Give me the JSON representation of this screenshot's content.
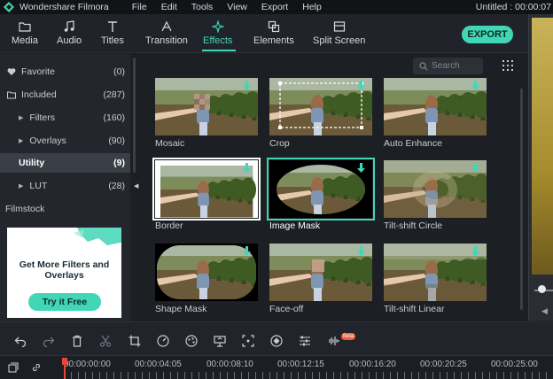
{
  "window": {
    "app_name": "Wondershare Filmora",
    "doc_title": "Untitled : 00:00:07",
    "menu": [
      "File",
      "Edit",
      "Tools",
      "View",
      "Export",
      "Help"
    ]
  },
  "toolbar": {
    "tabs": [
      {
        "label": "Media",
        "icon": "folder-icon"
      },
      {
        "label": "Audio",
        "icon": "music-note-icon"
      },
      {
        "label": "Titles",
        "icon": "text-icon"
      },
      {
        "label": "Transition",
        "icon": "transition-icon"
      },
      {
        "label": "Effects",
        "icon": "sparkle-icon",
        "active": true
      },
      {
        "label": "Elements",
        "icon": "elements-icon"
      },
      {
        "label": "Split Screen",
        "icon": "split-screen-icon"
      }
    ],
    "export_label": "EXPORT",
    "accent": "#41d6b6"
  },
  "sidebar": {
    "items": [
      {
        "label": "Favorite",
        "count": "(0)",
        "icon": "heart-icon"
      },
      {
        "label": "Included",
        "count": "(287)",
        "icon": "folder-icon"
      },
      {
        "label": "Filters",
        "count": "(160)"
      },
      {
        "label": "Overlays",
        "count": "(90)"
      },
      {
        "label": "Utility",
        "count": "(9)",
        "active": true
      },
      {
        "label": "LUT",
        "count": "(28)"
      }
    ],
    "filmstock_label": "Filmstock",
    "ad": {
      "title": "Get More Filters and Overlays",
      "button": "Try it Free"
    }
  },
  "search": {
    "placeholder": "Search"
  },
  "effects": [
    {
      "label": "Mosaic"
    },
    {
      "label": "Crop"
    },
    {
      "label": "Auto Enhance"
    },
    {
      "label": "Border"
    },
    {
      "label": "Image Mask"
    },
    {
      "label": "Tilt-shift Circle"
    },
    {
      "label": "Shape Mask"
    },
    {
      "label": "Face-off"
    },
    {
      "label": "Tilt-shift Linear"
    }
  ],
  "edit_tools": [
    "undo-icon",
    "redo-icon",
    "delete-icon",
    "cut-icon",
    "crop-icon",
    "speed-icon",
    "color-icon",
    "green-screen-icon",
    "stabilize-icon",
    "keyframe-icon",
    "adjust-icon",
    "audio-icon"
  ],
  "edit_tools_badge": "Beta",
  "timeline": {
    "ticks": [
      "00:00:00:00",
      "00:00:04:05",
      "00:00:08:10",
      "00:00:12:15",
      "00:00:16:20",
      "00:00:20:25",
      "00:00:25:00"
    ]
  }
}
